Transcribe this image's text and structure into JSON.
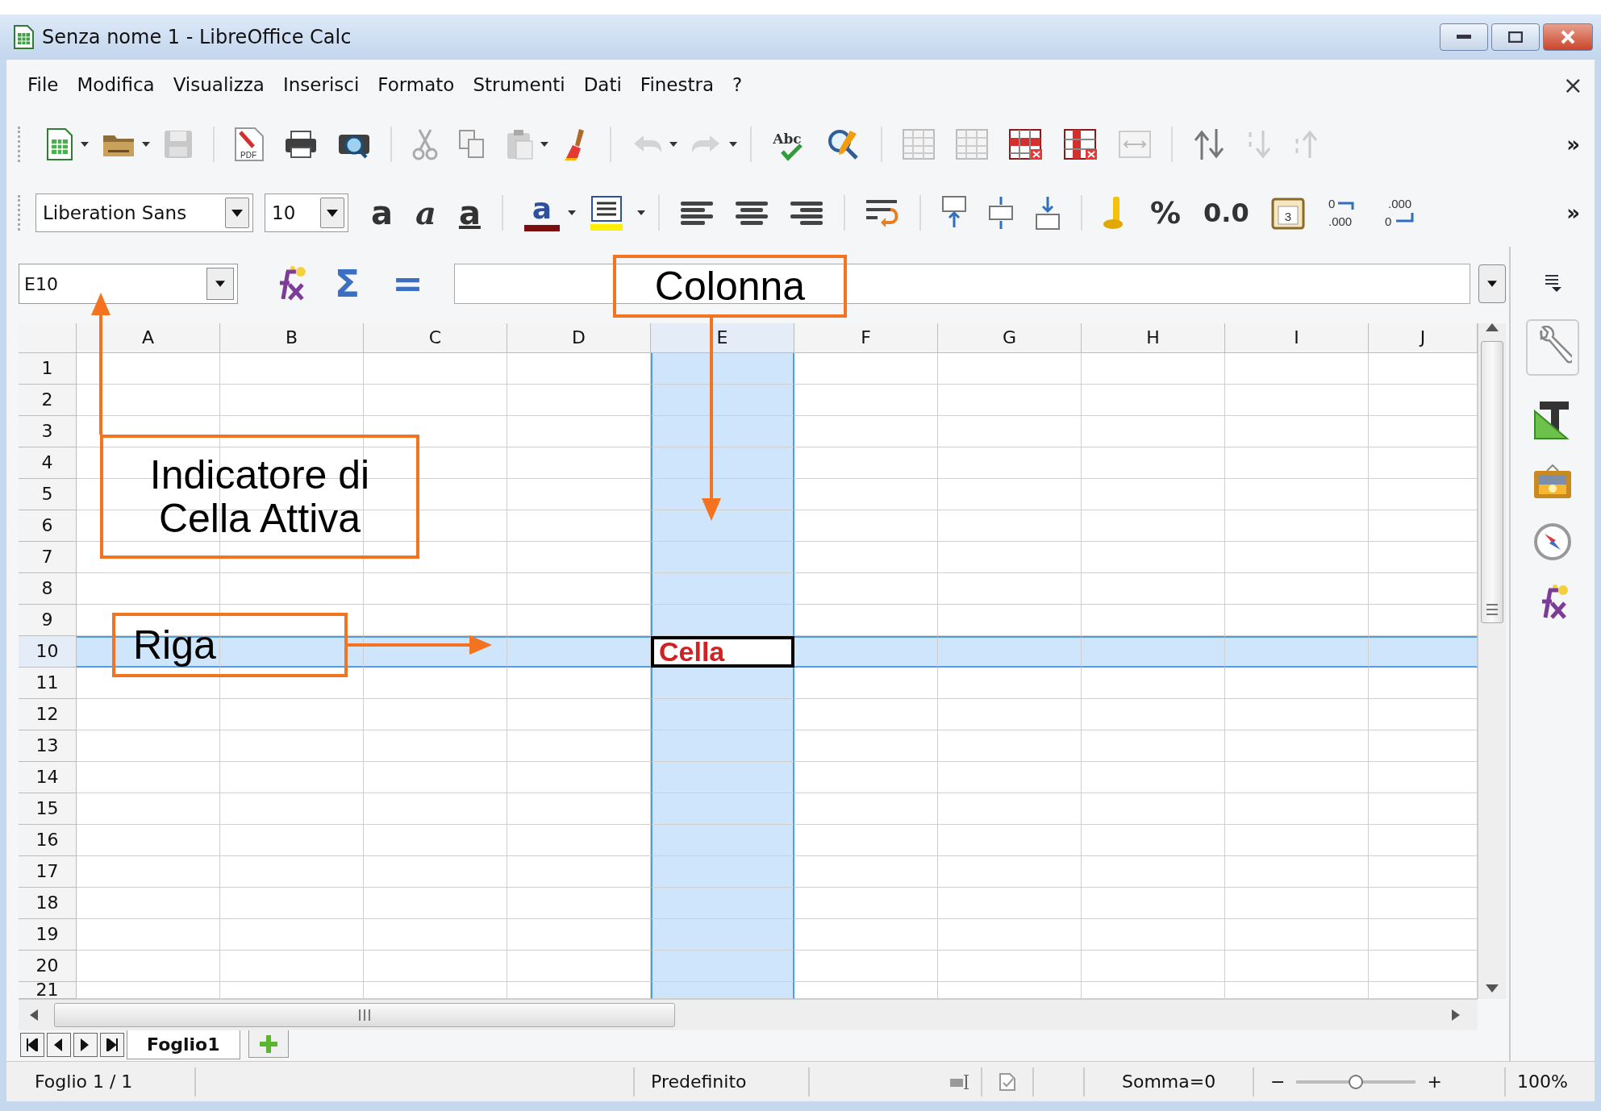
{
  "window": {
    "title": "Senza nome 1 - LibreOffice Calc"
  },
  "menu": {
    "items": [
      "File",
      "Modifica",
      "Visualizza",
      "Inserisci",
      "Formato",
      "Strumenti",
      "Dati",
      "Finestra",
      "?"
    ],
    "close": "×"
  },
  "standard_toolbar": {
    "pdf_label": "PDF",
    "spellcheck_label": "Abc",
    "overflow": "»"
  },
  "formatting_toolbar": {
    "font_name": "Liberation Sans",
    "font_size": "10",
    "bold": "a",
    "italic": "a",
    "underline": "a",
    "font_color": "a",
    "percent": "%",
    "number_format": "0.0",
    "calendar_day": "3",
    "add_decimal": [
      "0",
      ".000"
    ],
    "delete_decimal": [
      ".000",
      "0"
    ],
    "overflow": "»"
  },
  "formula_bar": {
    "name_box": "E10",
    "sum": "Σ",
    "equals": "="
  },
  "sheet": {
    "columns": [
      {
        "label": "A",
        "selected": false
      },
      {
        "label": "B",
        "selected": false
      },
      {
        "label": "C",
        "selected": false
      },
      {
        "label": "D",
        "selected": false
      },
      {
        "label": "E",
        "selected": true
      },
      {
        "label": "F",
        "selected": false
      },
      {
        "label": "G",
        "selected": false
      },
      {
        "label": "H",
        "selected": false
      },
      {
        "label": "I",
        "selected": false
      },
      {
        "label": "J",
        "selected": false
      }
    ],
    "rows": [
      {
        "label": "1",
        "selected": false
      },
      {
        "label": "2",
        "selected": false
      },
      {
        "label": "3",
        "selected": false
      },
      {
        "label": "4",
        "selected": false
      },
      {
        "label": "5",
        "selected": false
      },
      {
        "label": "6",
        "selected": false
      },
      {
        "label": "7",
        "selected": false
      },
      {
        "label": "8",
        "selected": false
      },
      {
        "label": "9",
        "selected": false
      },
      {
        "label": "10",
        "selected": true
      },
      {
        "label": "11",
        "selected": false
      },
      {
        "label": "12",
        "selected": false
      },
      {
        "label": "13",
        "selected": false
      },
      {
        "label": "14",
        "selected": false
      },
      {
        "label": "15",
        "selected": false
      },
      {
        "label": "16",
        "selected": false
      },
      {
        "label": "17",
        "selected": false
      },
      {
        "label": "18",
        "selected": false
      },
      {
        "label": "19",
        "selected": false
      },
      {
        "label": "20",
        "selected": false
      },
      {
        "label": "21",
        "selected": false
      }
    ],
    "active_cell": {
      "text": "Cella"
    }
  },
  "sheet_tabs": [
    {
      "label": "Foglio1",
      "selected": true
    }
  ],
  "status_bar": {
    "sheet": "Foglio 1 / 1",
    "page_style": "Predefinito",
    "sum": "Somma=0",
    "zoom_out": "−",
    "zoom_in": "+",
    "zoom": {
      "level": 0.5
    },
    "zoom_percent": "100%"
  },
  "annotations": [
    {
      "kind": "column",
      "lines": [
        "Colonna"
      ]
    },
    {
      "kind": "indicator",
      "lines": [
        "Indicatore di",
        "Cella Attiva"
      ]
    },
    {
      "kind": "row",
      "lines": [
        "Riga"
      ]
    }
  ]
}
